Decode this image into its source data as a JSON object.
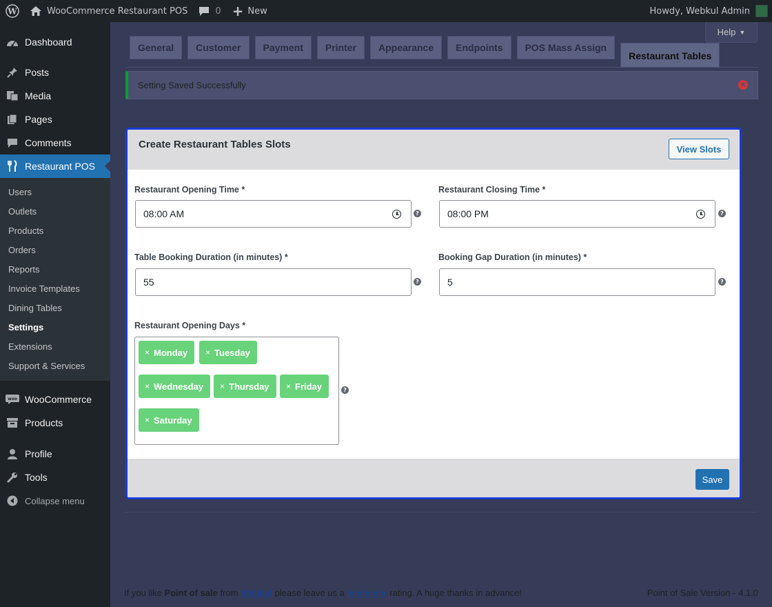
{
  "adminbar": {
    "site_name": "WooCommerce Restaurant POS",
    "comments_count": "0",
    "new_label": "New",
    "howdy": "Howdy, Webkul Admin"
  },
  "sidebar": {
    "items_top": [
      {
        "label": "Dashboard",
        "icon": "dashboard-icon"
      },
      {
        "label": "Posts",
        "icon": "pin-icon"
      },
      {
        "label": "Media",
        "icon": "media-icon"
      },
      {
        "label": "Pages",
        "icon": "pages-icon"
      },
      {
        "label": "Comments",
        "icon": "comments-icon"
      },
      {
        "label": "Restaurant POS",
        "icon": "utensils-icon"
      }
    ],
    "submenu": [
      "Users",
      "Outlets",
      "Products",
      "Orders",
      "Reports",
      "Invoice Templates",
      "Dining Tables",
      "Settings",
      "Extensions",
      "Support & Services"
    ],
    "items_bottom": [
      {
        "label": "WooCommerce",
        "icon": "woo-icon"
      },
      {
        "label": "Products",
        "icon": "archive-icon"
      },
      {
        "label": "Profile",
        "icon": "user-icon"
      },
      {
        "label": "Tools",
        "icon": "wrench-icon"
      }
    ],
    "collapse_label": "Collapse menu"
  },
  "help_label": "Help",
  "tabs": [
    "General",
    "Customer",
    "Payment",
    "Printer",
    "Appearance",
    "Endpoints",
    "POS Mass Assign",
    "Restaurant Tables"
  ],
  "notice": "Setting Saved Successfully",
  "card": {
    "title": "Create Restaurant Tables Slots",
    "view_slots": "View Slots",
    "opening_label": "Restaurant Opening Time *",
    "opening_value": "08:00 AM",
    "closing_label": "Restaurant Closing Time *",
    "closing_value": "08:00 PM",
    "duration_label": "Table Booking Duration (in minutes) *",
    "duration_value": "55",
    "gap_label": "Booking Gap Duration (in minutes) *",
    "gap_value": "5",
    "days_label": "Restaurant Opening Days *",
    "days": [
      "Monday",
      "Tuesday",
      "Wednesday",
      "Thursday",
      "Friday",
      "Saturday"
    ],
    "save": "Save"
  },
  "footer": {
    "part1": "If you like ",
    "product": "Point of sale",
    "part2": " from ",
    "vendor": "Webkul",
    "part3": " please leave us a ",
    "stars": "★★★★★",
    "part4": " rating. A huge thanks in advance!",
    "version": "Point of Sale Version - 4.1.0"
  },
  "colors": {
    "accent": "#2271b1",
    "chip": "#68d37a",
    "focus_border": "#1a3cd8",
    "success": "#00a32a"
  }
}
